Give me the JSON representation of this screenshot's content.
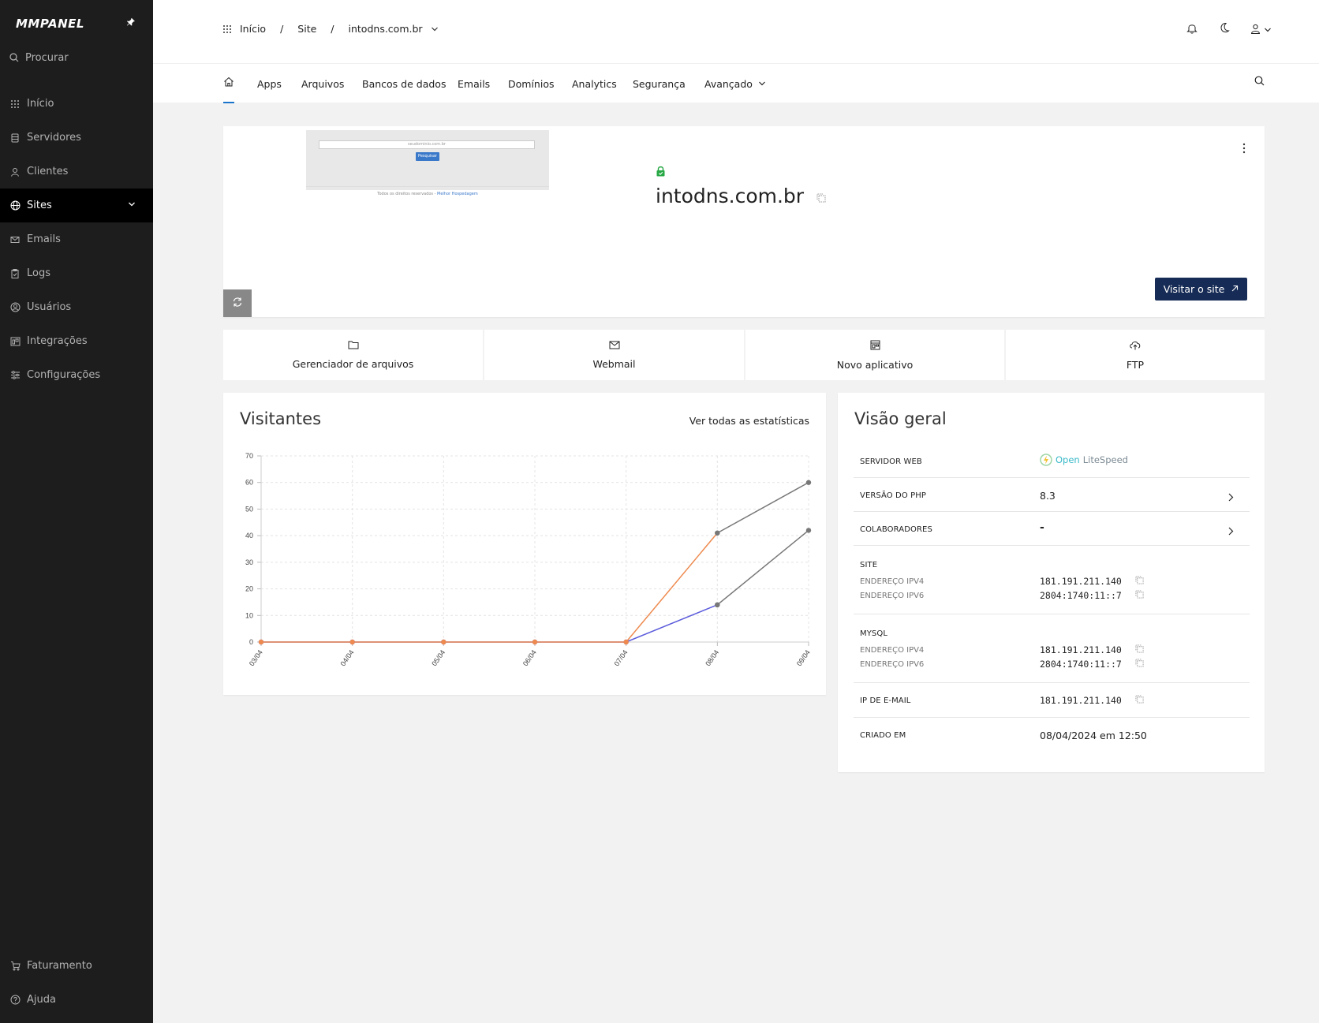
{
  "sidebar": {
    "logo": "MMPANEL",
    "search": "Procurar",
    "items": [
      {
        "label": "Início",
        "icon": "grid-icon"
      },
      {
        "label": "Servidores",
        "icon": "server-icon"
      },
      {
        "label": "Clientes",
        "icon": "user-icon"
      },
      {
        "label": "Sites",
        "icon": "globe-icon",
        "active": true
      },
      {
        "label": "Emails",
        "icon": "mail-icon"
      },
      {
        "label": "Logs",
        "icon": "clipboard-icon"
      },
      {
        "label": "Usuários",
        "icon": "user-circle-icon"
      },
      {
        "label": "Integrações",
        "icon": "integrations-icon"
      },
      {
        "label": "Configurações",
        "icon": "settings-icon"
      }
    ],
    "footer": [
      {
        "label": "Faturamento",
        "icon": "cart-icon"
      },
      {
        "label": "Ajuda",
        "icon": "help-icon"
      }
    ]
  },
  "breadcrumb": {
    "home": "Início",
    "site": "Site",
    "domain": "intodns.com.br"
  },
  "tabs": [
    "Apps",
    "Arquivos",
    "Bancos de dados",
    "Emails",
    "Domínios",
    "Analytics",
    "Segurança",
    "Avançado"
  ],
  "site": {
    "domain": "intodns.com.br",
    "preview_input": "seudominio.com.br",
    "preview_button": "Pesquisar",
    "preview_footer": "Todos os direitos reservados - ",
    "preview_footer_link": "Melhor Hospedagem",
    "visit_button": "Visitar o site"
  },
  "quick_actions": [
    {
      "label": "Gerenciador de arquivos",
      "icon": "folder-icon"
    },
    {
      "label": "Webmail",
      "icon": "mail-icon"
    },
    {
      "label": "Novo aplicativo",
      "icon": "app-icon"
    },
    {
      "label": "FTP",
      "icon": "cloud-upload-icon"
    }
  ],
  "visitors": {
    "title": "Visitantes",
    "link": "Ver todas as estatísticas"
  },
  "chart_data": {
    "type": "line",
    "categories": [
      "03/04",
      "04/04",
      "05/04",
      "06/04",
      "07/04",
      "08/04",
      "09/04"
    ],
    "ylim": [
      0,
      70
    ],
    "yticks": [
      0,
      10,
      20,
      30,
      40,
      50,
      60,
      70
    ],
    "grid": true,
    "series": [
      {
        "color": "#ee8a4f",
        "values": [
          0,
          0,
          0,
          0,
          0,
          41,
          null
        ]
      },
      {
        "color": "#5b5bdc",
        "values": [
          0,
          0,
          0,
          0,
          0,
          14,
          null
        ]
      },
      {
        "color": "#777777",
        "values": [
          null,
          null,
          null,
          null,
          null,
          41,
          60
        ]
      },
      {
        "color": "#777777",
        "values": [
          null,
          null,
          null,
          null,
          null,
          14,
          42
        ]
      }
    ]
  },
  "overview": {
    "title": "Visão geral",
    "web_server_label": "SERVIDOR WEB",
    "web_server_value_a": "Open",
    "web_server_value_b": "LiteSpeed",
    "php_label": "VERSÃO DO PHP",
    "php_value": "8.3",
    "collab_label": "COLABORADORES",
    "collab_value": "-",
    "site_label": "SITE",
    "ipv4_label": "ENDEREÇO IPV4",
    "ipv6_label": "ENDEREÇO IPV6",
    "site_ipv4": "181.191.211.140",
    "site_ipv6": "2804:1740:11::7",
    "mysql_label": "MYSQL",
    "mysql_ipv4": "181.191.211.140",
    "mysql_ipv6": "2804:1740:11::7",
    "email_ip_label": "IP DE E-MAIL",
    "email_ip": "181.191.211.140",
    "created_label": "CRIADO EM",
    "created_value": "08/04/2024 em 12:50"
  }
}
